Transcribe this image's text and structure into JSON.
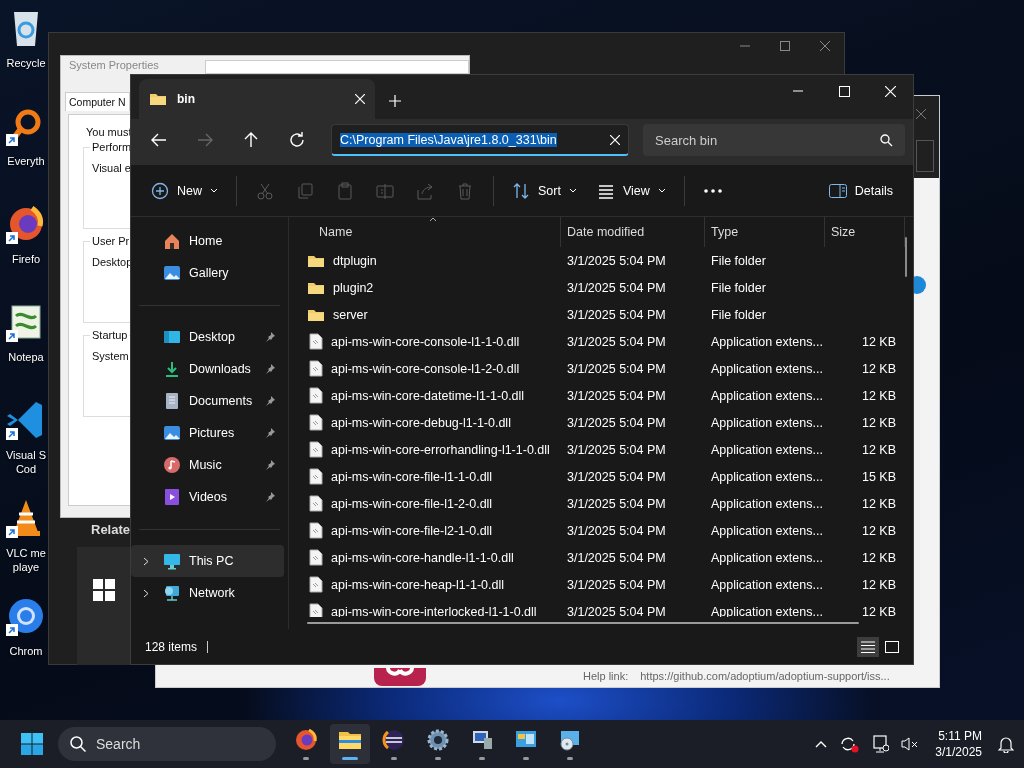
{
  "desktop": {
    "icons": [
      {
        "label": "Recycle",
        "shortcut": false
      },
      {
        "label": "Everyth",
        "shortcut": true
      },
      {
        "label": "Firefo",
        "shortcut": true
      },
      {
        "label": "Notepa",
        "shortcut": true
      },
      {
        "label": "Visual S\nCod",
        "shortcut": true
      },
      {
        "label": "VLC me\nplaye",
        "shortcut": true
      },
      {
        "label": "Chrom",
        "shortcut": true
      }
    ]
  },
  "settings_window": {
    "heading": "Relate"
  },
  "help_window": {
    "help_label": "Help link:",
    "help_url": "https://github.com/adoptium/adoptium-support/iss..."
  },
  "system_properties": {
    "title": "System Properties",
    "tab": "Computer N",
    "intro": "You must",
    "groups": [
      {
        "title": "Perform",
        "text": "Visual e"
      },
      {
        "title": "User Pr",
        "text": "Desktop"
      },
      {
        "title": "Startup",
        "text": "System"
      }
    ]
  },
  "explorer": {
    "tab": {
      "title": "bin",
      "selected": true
    },
    "nav_buttons": [
      {
        "kind": "back",
        "disabled": false
      },
      {
        "kind": "forward",
        "disabled": true
      },
      {
        "kind": "up",
        "disabled": false
      },
      {
        "kind": "refresh",
        "disabled": false
      }
    ],
    "address": {
      "value": "C:\\Program Files\\Java\\jre1.8.0_331\\bin",
      "focused": true,
      "text_selected": true
    },
    "search": {
      "placeholder": "Search bin"
    },
    "toolbar": {
      "groups": [
        [
          {
            "kind": "new",
            "label": "New",
            "dropdown": true
          }
        ],
        [
          {
            "kind": "cut",
            "disabled": true
          },
          {
            "kind": "copy",
            "disabled": true
          },
          {
            "kind": "paste",
            "disabled": true
          },
          {
            "kind": "rename",
            "disabled": true
          },
          {
            "kind": "share",
            "disabled": true
          },
          {
            "kind": "delete",
            "disabled": true
          }
        ],
        [
          {
            "kind": "sort",
            "label": "Sort",
            "dropdown": true
          },
          {
            "kind": "view",
            "label": "View",
            "dropdown": true
          }
        ],
        [
          {
            "kind": "more"
          }
        ]
      ],
      "details": {
        "label": "Details"
      }
    },
    "sidebar": {
      "groups": [
        [
          {
            "label": "Home",
            "pinned": false,
            "expandable": false,
            "selected": false
          },
          {
            "label": "Gallery",
            "pinned": false,
            "expandable": false,
            "selected": false
          }
        ],
        [
          {
            "label": "Desktop",
            "pinned": true,
            "expandable": false,
            "selected": false
          },
          {
            "label": "Downloads",
            "pinned": true,
            "expandable": false,
            "selected": false
          },
          {
            "label": "Documents",
            "pinned": true,
            "expandable": false,
            "selected": false
          },
          {
            "label": "Pictures",
            "pinned": true,
            "expandable": false,
            "selected": false
          },
          {
            "label": "Music",
            "pinned": true,
            "expandable": false,
            "selected": false
          },
          {
            "label": "Videos",
            "pinned": true,
            "expandable": false,
            "selected": false
          }
        ],
        [
          {
            "label": "This PC",
            "pinned": false,
            "expandable": true,
            "selected": true
          },
          {
            "label": "Network",
            "pinned": false,
            "expandable": true,
            "selected": false
          }
        ]
      ]
    },
    "columns": [
      {
        "label": "Name",
        "sorted": true
      },
      {
        "label": "Date modified",
        "sorted": false
      },
      {
        "label": "Type",
        "sorted": false
      },
      {
        "label": "Size",
        "sorted": false
      }
    ],
    "files": [
      {
        "kind": "folder",
        "name": "dtplugin",
        "date": "3/1/2025 5:04 PM",
        "type": "File folder"
      },
      {
        "kind": "folder",
        "name": "plugin2",
        "date": "3/1/2025 5:04 PM",
        "type": "File folder"
      },
      {
        "kind": "folder",
        "name": "server",
        "date": "3/1/2025 5:04 PM",
        "type": "File folder"
      },
      {
        "kind": "file",
        "name": "api-ms-win-core-console-l1-1-0.dll",
        "date": "3/1/2025 5:04 PM",
        "type": "Application extens...",
        "size": "12 KB"
      },
      {
        "kind": "file",
        "name": "api-ms-win-core-console-l1-2-0.dll",
        "date": "3/1/2025 5:04 PM",
        "type": "Application extens...",
        "size": "12 KB"
      },
      {
        "kind": "file",
        "name": "api-ms-win-core-datetime-l1-1-0.dll",
        "date": "3/1/2025 5:04 PM",
        "type": "Application extens...",
        "size": "12 KB"
      },
      {
        "kind": "file",
        "name": "api-ms-win-core-debug-l1-1-0.dll",
        "date": "3/1/2025 5:04 PM",
        "type": "Application extens...",
        "size": "12 KB"
      },
      {
        "kind": "file",
        "name": "api-ms-win-core-errorhandling-l1-1-0.dll",
        "date": "3/1/2025 5:04 PM",
        "type": "Application extens...",
        "size": "12 KB"
      },
      {
        "kind": "file",
        "name": "api-ms-win-core-file-l1-1-0.dll",
        "date": "3/1/2025 5:04 PM",
        "type": "Application extens...",
        "size": "15 KB"
      },
      {
        "kind": "file",
        "name": "api-ms-win-core-file-l1-2-0.dll",
        "date": "3/1/2025 5:04 PM",
        "type": "Application extens...",
        "size": "12 KB"
      },
      {
        "kind": "file",
        "name": "api-ms-win-core-file-l2-1-0.dll",
        "date": "3/1/2025 5:04 PM",
        "type": "Application extens...",
        "size": "12 KB"
      },
      {
        "kind": "file",
        "name": "api-ms-win-core-handle-l1-1-0.dll",
        "date": "3/1/2025 5:04 PM",
        "type": "Application extens...",
        "size": "12 KB"
      },
      {
        "kind": "file",
        "name": "api-ms-win-core-heap-l1-1-0.dll",
        "date": "3/1/2025 5:04 PM",
        "type": "Application extens...",
        "size": "12 KB"
      },
      {
        "kind": "file",
        "name": "api-ms-win-core-interlocked-l1-1-0.dll",
        "date": "3/1/2025 5:04 PM",
        "type": "Application extens...",
        "size": "12 KB"
      }
    ],
    "status": {
      "count": "128 items"
    },
    "view_toggles": [
      {
        "kind": "details",
        "selected": true
      },
      {
        "kind": "tiles",
        "selected": false
      }
    ]
  },
  "taskbar": {
    "search": {
      "placeholder": "Search"
    },
    "apps": [
      {
        "active": false
      },
      {
        "active": true
      },
      {
        "active": false
      },
      {
        "active": false
      },
      {
        "active": false
      },
      {
        "active": false
      },
      {
        "active": false
      }
    ],
    "time": "5:11 PM",
    "date": "3/1/2025"
  }
}
